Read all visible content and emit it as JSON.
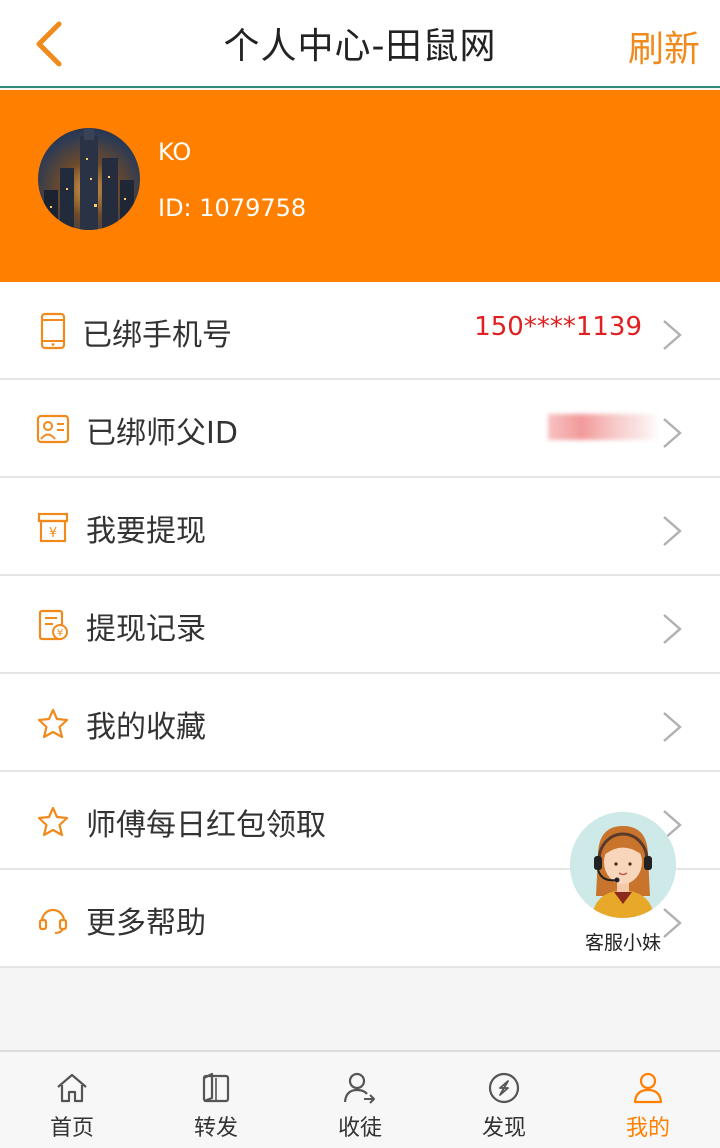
{
  "header": {
    "title": "个人中心-田鼠网",
    "refresh_label": "刷新"
  },
  "profile": {
    "username": "KO",
    "user_id": "ID: 1079758"
  },
  "menu": [
    {
      "label": "已绑手机号",
      "value": "150****1139",
      "icon": "phone-icon"
    },
    {
      "label": "已绑师父ID",
      "value": "",
      "icon": "id-card-icon"
    },
    {
      "label": "我要提现",
      "value": "",
      "icon": "withdraw-box-icon"
    },
    {
      "label": "提现记录",
      "value": "",
      "icon": "record-doc-icon"
    },
    {
      "label": "我的收藏",
      "value": "",
      "icon": "star-icon"
    },
    {
      "label": "师傅每日红包领取",
      "value": "",
      "icon": "star-icon"
    },
    {
      "label": "更多帮助",
      "value": "",
      "icon": "headset-icon"
    }
  ],
  "customer_service": {
    "label": "客服小妹"
  },
  "tabbar": [
    {
      "label": "首页",
      "icon": "home-icon",
      "active": false
    },
    {
      "label": "转发",
      "icon": "book-icon",
      "active": false
    },
    {
      "label": "收徒",
      "icon": "add-user-icon",
      "active": false
    },
    {
      "label": "发现",
      "icon": "compass-icon",
      "active": false
    },
    {
      "label": "我的",
      "icon": "user-icon",
      "active": true
    }
  ],
  "colors": {
    "accent": "#ff7f00",
    "value_red": "#e02020",
    "header_border": "#2a8a7a"
  }
}
